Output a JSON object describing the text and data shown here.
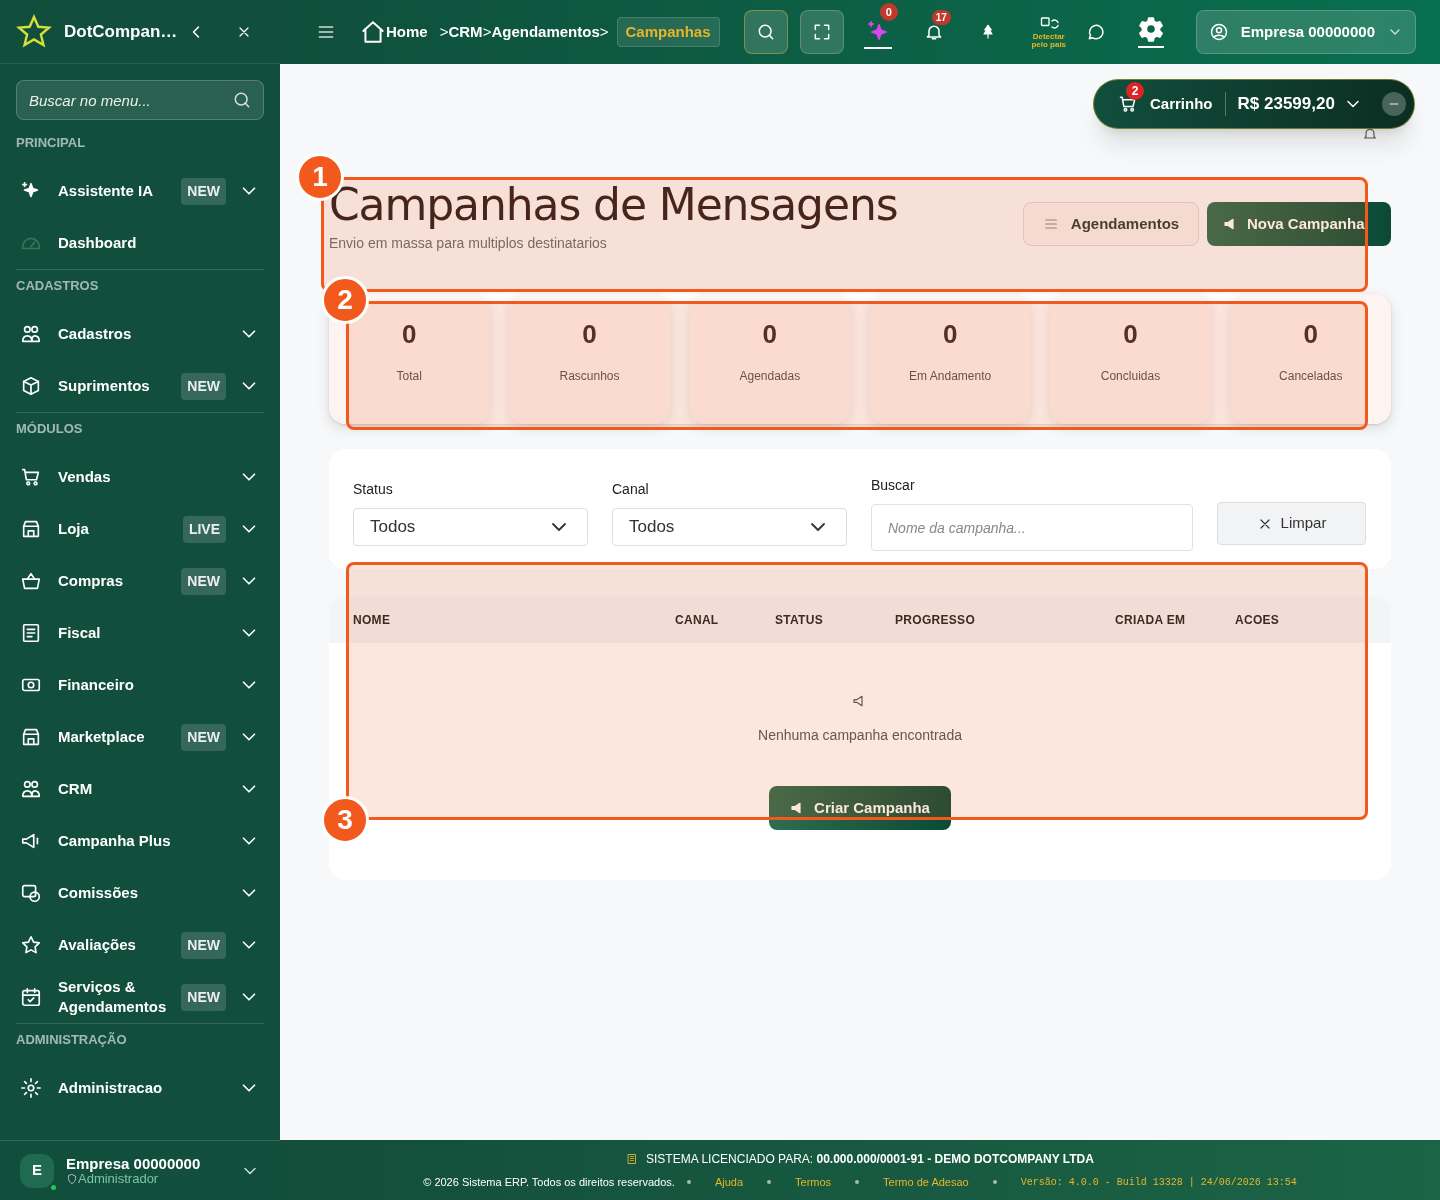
{
  "sidebar": {
    "brand": "DotCompan…",
    "search_placeholder": "Buscar no menu...",
    "sections": [
      {
        "title": "PRINCIPAL",
        "items": [
          {
            "label": "Assistente IA",
            "badge": "NEW",
            "has_submenu": true
          },
          {
            "label": "Dashboard",
            "has_submenu": false
          }
        ]
      },
      {
        "title": "CADASTROS",
        "items": [
          {
            "label": "Cadastros",
            "has_submenu": true
          },
          {
            "label": "Suprimentos",
            "badge": "NEW",
            "has_submenu": true
          }
        ]
      },
      {
        "title": "MÓDULOS",
        "items": [
          {
            "label": "Vendas",
            "has_submenu": true
          },
          {
            "label": "Loja",
            "badge": "LIVE",
            "has_submenu": true
          },
          {
            "label": "Compras",
            "badge": "NEW",
            "has_submenu": true
          },
          {
            "label": "Fiscal",
            "has_submenu": true
          },
          {
            "label": "Financeiro",
            "has_submenu": true
          },
          {
            "label": "Marketplace",
            "badge": "NEW",
            "has_submenu": true
          },
          {
            "label": "CRM",
            "has_submenu": true
          },
          {
            "label": "Campanha Plus",
            "has_submenu": true
          },
          {
            "label": "Comissões",
            "has_submenu": true
          },
          {
            "label": "Avaliações",
            "badge": "NEW",
            "has_submenu": true
          },
          {
            "label": "Serviços & Agendamentos",
            "badge": "NEW",
            "has_submenu": true
          }
        ]
      },
      {
        "title": "ADMINISTRAÇÃO",
        "items": [
          {
            "label": "Administracao",
            "has_submenu": true
          }
        ]
      }
    ],
    "user": {
      "initial": "E",
      "name": "Empresa 00000000",
      "role": "Administrador",
      "online": true
    }
  },
  "topbar": {
    "breadcrumb": [
      {
        "label": "Home",
        "current": false
      },
      {
        "label": "CRM",
        "current": false
      },
      {
        "label": "Agendamentos",
        "current": false
      },
      {
        "label": "Campanhas",
        "current": true
      }
    ],
    "separator": ">",
    "ai_badge": "0",
    "notifications_badge": "17",
    "language_hint": "Detectar pelo pais",
    "company": "Empresa 00000000"
  },
  "cart": {
    "label": "Carrinho",
    "count": "2",
    "total": "R$ 23599,20"
  },
  "page": {
    "title": "Campanhas de Mensagens",
    "subtitle": "Envio em massa para multiplos destinatarios",
    "buttons": [
      {
        "label": "Agendamentos",
        "kind": "secondary"
      },
      {
        "label": "Nova Campanha",
        "kind": "primary"
      }
    ]
  },
  "stats": [
    {
      "value": "0",
      "label": "Total"
    },
    {
      "value": "0",
      "label": "Rascunhos"
    },
    {
      "value": "0",
      "label": "Agendadas"
    },
    {
      "value": "0",
      "label": "Em Andamento"
    },
    {
      "value": "0",
      "label": "Concluidas"
    },
    {
      "value": "0",
      "label": "Canceladas"
    }
  ],
  "filters": [
    {
      "kind": "select",
      "label": "Status",
      "value": "Todos"
    },
    {
      "kind": "select",
      "label": "Canal",
      "value": "Todos"
    },
    {
      "kind": "text",
      "label": "Buscar",
      "placeholder": "Nome da campanha..."
    }
  ],
  "clear_button": "Limpar",
  "table": {
    "columns": [
      "NOME",
      "CANAL",
      "STATUS",
      "PROGRESSO",
      "CRIADA EM",
      "ACOES"
    ],
    "empty_message": "Nenhuma campanha encontrada",
    "empty_action": "Criar Campanha"
  },
  "footer": {
    "license": "SISTEMA LICENCIADO PARA: **00.000.000/0001-91 - DEMO DOTCOMPANY LTDA**",
    "copyright": "© 2026 Sistema ERP. Todos os direitos reservados.",
    "links": [
      "Ajuda",
      "Termos",
      "Termo de Adesao"
    ],
    "version": "Versão: 4.0.0 - Build 13328 | 24/06/2026 13:54"
  },
  "annotations": [
    {
      "label": "1"
    },
    {
      "label": "2"
    },
    {
      "label": "3"
    }
  ]
}
